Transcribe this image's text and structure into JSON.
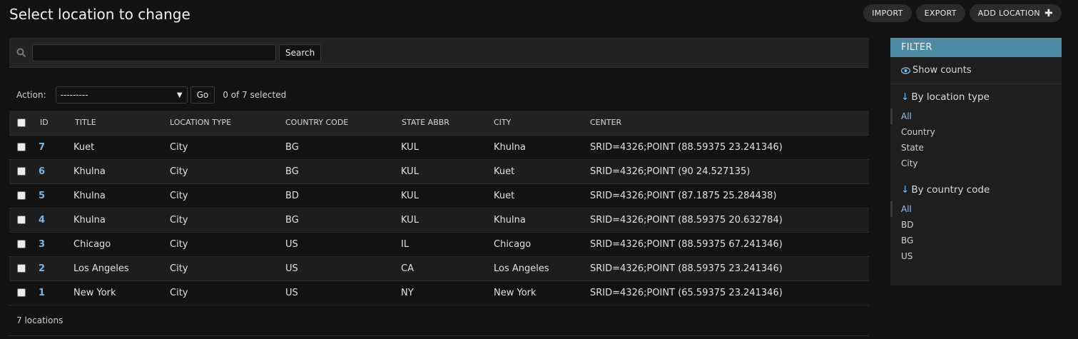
{
  "page": {
    "title": "Select location to change"
  },
  "object_tools": {
    "import_label": "IMPORT",
    "export_label": "EXPORT",
    "add_label": "ADD LOCATION"
  },
  "search": {
    "value": "",
    "placeholder": "",
    "button_label": "Search"
  },
  "actions": {
    "label": "Action:",
    "selected_option": "---------",
    "go_label": "Go",
    "selected_count": "0 of 7 selected"
  },
  "table": {
    "columns": [
      "ID",
      "TITLE",
      "LOCATION TYPE",
      "COUNTRY CODE",
      "STATE ABBR",
      "CITY",
      "CENTER"
    ],
    "rows": [
      {
        "id": "7",
        "title": "Kuet",
        "type": "City",
        "country": "BG",
        "state": "KUL",
        "city": "Khulna",
        "center": "SRID=4326;POINT (88.59375 23.241346)"
      },
      {
        "id": "6",
        "title": "Khulna",
        "type": "City",
        "country": "BG",
        "state": "KUL",
        "city": "Kuet",
        "center": "SRID=4326;POINT (90 24.527135)"
      },
      {
        "id": "5",
        "title": "Khulna",
        "type": "City",
        "country": "BD",
        "state": "KUL",
        "city": "Kuet",
        "center": "SRID=4326;POINT (87.1875 25.284438)"
      },
      {
        "id": "4",
        "title": "Khulna",
        "type": "City",
        "country": "BG",
        "state": "KUL",
        "city": "Khulna",
        "center": "SRID=4326;POINT (88.59375 20.632784)"
      },
      {
        "id": "3",
        "title": "Chicago",
        "type": "City",
        "country": "US",
        "state": "IL",
        "city": "Chicago",
        "center": "SRID=4326;POINT (88.59375 67.241346)"
      },
      {
        "id": "2",
        "title": "Los Angeles",
        "type": "City",
        "country": "US",
        "state": "CA",
        "city": "Los Angeles",
        "center": "SRID=4326;POINT (88.59375 23.241346)"
      },
      {
        "id": "1",
        "title": "New York",
        "type": "City",
        "country": "US",
        "state": "NY",
        "city": "New York",
        "center": "SRID=4326;POINT (65.59375 23.241346)"
      }
    ],
    "footer": "7 locations"
  },
  "filter": {
    "header": "FILTER",
    "show_counts": "Show counts",
    "sections": [
      {
        "title": "By location type",
        "items": [
          "All",
          "Country",
          "State",
          "City"
        ]
      },
      {
        "title": "By country code",
        "items": [
          "All",
          "BD",
          "BG",
          "US"
        ]
      }
    ]
  },
  "colors": {
    "accent": "#4d8aa3",
    "link": "#7ab7e6",
    "background": "#121212"
  },
  "icons": {
    "search": "search-icon",
    "eye": "eye-icon",
    "plus": "plus-icon"
  }
}
